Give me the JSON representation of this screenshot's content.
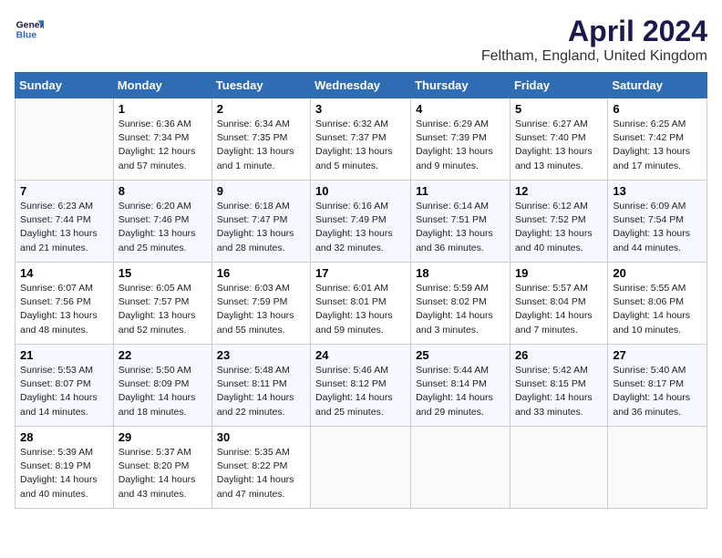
{
  "header": {
    "logo_line1": "General",
    "logo_line2": "Blue",
    "title": "April 2024",
    "subtitle": "Feltham, England, United Kingdom"
  },
  "weekdays": [
    "Sunday",
    "Monday",
    "Tuesday",
    "Wednesday",
    "Thursday",
    "Friday",
    "Saturday"
  ],
  "weeks": [
    [
      {
        "day": "",
        "empty": true
      },
      {
        "day": "1",
        "sunrise": "6:36 AM",
        "sunset": "7:34 PM",
        "daylight": "12 hours and 57 minutes."
      },
      {
        "day": "2",
        "sunrise": "6:34 AM",
        "sunset": "7:35 PM",
        "daylight": "13 hours and 1 minute."
      },
      {
        "day": "3",
        "sunrise": "6:32 AM",
        "sunset": "7:37 PM",
        "daylight": "13 hours and 5 minutes."
      },
      {
        "day": "4",
        "sunrise": "6:29 AM",
        "sunset": "7:39 PM",
        "daylight": "13 hours and 9 minutes."
      },
      {
        "day": "5",
        "sunrise": "6:27 AM",
        "sunset": "7:40 PM",
        "daylight": "13 hours and 13 minutes."
      },
      {
        "day": "6",
        "sunrise": "6:25 AM",
        "sunset": "7:42 PM",
        "daylight": "13 hours and 17 minutes."
      }
    ],
    [
      {
        "day": "7",
        "sunrise": "6:23 AM",
        "sunset": "7:44 PM",
        "daylight": "13 hours and 21 minutes."
      },
      {
        "day": "8",
        "sunrise": "6:20 AM",
        "sunset": "7:46 PM",
        "daylight": "13 hours and 25 minutes."
      },
      {
        "day": "9",
        "sunrise": "6:18 AM",
        "sunset": "7:47 PM",
        "daylight": "13 hours and 28 minutes."
      },
      {
        "day": "10",
        "sunrise": "6:16 AM",
        "sunset": "7:49 PM",
        "daylight": "13 hours and 32 minutes."
      },
      {
        "day": "11",
        "sunrise": "6:14 AM",
        "sunset": "7:51 PM",
        "daylight": "13 hours and 36 minutes."
      },
      {
        "day": "12",
        "sunrise": "6:12 AM",
        "sunset": "7:52 PM",
        "daylight": "13 hours and 40 minutes."
      },
      {
        "day": "13",
        "sunrise": "6:09 AM",
        "sunset": "7:54 PM",
        "daylight": "13 hours and 44 minutes."
      }
    ],
    [
      {
        "day": "14",
        "sunrise": "6:07 AM",
        "sunset": "7:56 PM",
        "daylight": "13 hours and 48 minutes."
      },
      {
        "day": "15",
        "sunrise": "6:05 AM",
        "sunset": "7:57 PM",
        "daylight": "13 hours and 52 minutes."
      },
      {
        "day": "16",
        "sunrise": "6:03 AM",
        "sunset": "7:59 PM",
        "daylight": "13 hours and 55 minutes."
      },
      {
        "day": "17",
        "sunrise": "6:01 AM",
        "sunset": "8:01 PM",
        "daylight": "13 hours and 59 minutes."
      },
      {
        "day": "18",
        "sunrise": "5:59 AM",
        "sunset": "8:02 PM",
        "daylight": "14 hours and 3 minutes."
      },
      {
        "day": "19",
        "sunrise": "5:57 AM",
        "sunset": "8:04 PM",
        "daylight": "14 hours and 7 minutes."
      },
      {
        "day": "20",
        "sunrise": "5:55 AM",
        "sunset": "8:06 PM",
        "daylight": "14 hours and 10 minutes."
      }
    ],
    [
      {
        "day": "21",
        "sunrise": "5:53 AM",
        "sunset": "8:07 PM",
        "daylight": "14 hours and 14 minutes."
      },
      {
        "day": "22",
        "sunrise": "5:50 AM",
        "sunset": "8:09 PM",
        "daylight": "14 hours and 18 minutes."
      },
      {
        "day": "23",
        "sunrise": "5:48 AM",
        "sunset": "8:11 PM",
        "daylight": "14 hours and 22 minutes."
      },
      {
        "day": "24",
        "sunrise": "5:46 AM",
        "sunset": "8:12 PM",
        "daylight": "14 hours and 25 minutes."
      },
      {
        "day": "25",
        "sunrise": "5:44 AM",
        "sunset": "8:14 PM",
        "daylight": "14 hours and 29 minutes."
      },
      {
        "day": "26",
        "sunrise": "5:42 AM",
        "sunset": "8:15 PM",
        "daylight": "14 hours and 33 minutes."
      },
      {
        "day": "27",
        "sunrise": "5:40 AM",
        "sunset": "8:17 PM",
        "daylight": "14 hours and 36 minutes."
      }
    ],
    [
      {
        "day": "28",
        "sunrise": "5:39 AM",
        "sunset": "8:19 PM",
        "daylight": "14 hours and 40 minutes."
      },
      {
        "day": "29",
        "sunrise": "5:37 AM",
        "sunset": "8:20 PM",
        "daylight": "14 hours and 43 minutes."
      },
      {
        "day": "30",
        "sunrise": "5:35 AM",
        "sunset": "8:22 PM",
        "daylight": "14 hours and 47 minutes."
      },
      {
        "day": "",
        "empty": true
      },
      {
        "day": "",
        "empty": true
      },
      {
        "day": "",
        "empty": true
      },
      {
        "day": "",
        "empty": true
      }
    ]
  ]
}
